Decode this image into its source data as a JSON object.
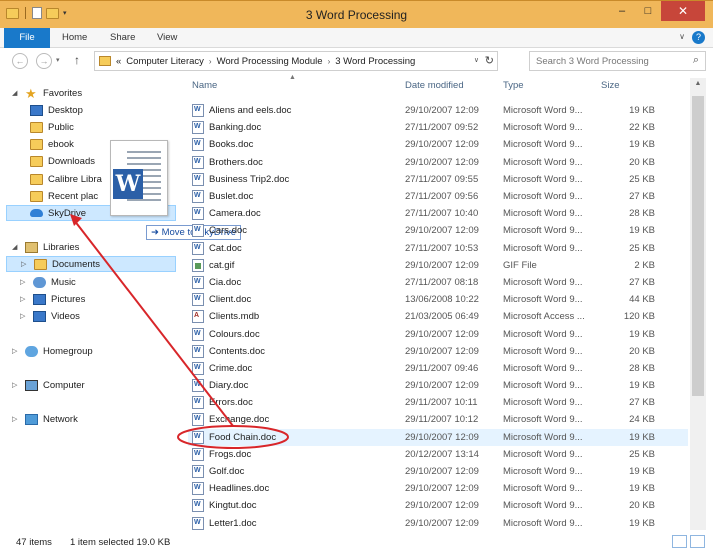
{
  "window": {
    "title": "3 Word Processing",
    "minimize": "–",
    "maximize": "□",
    "close": "✕"
  },
  "ribbon": {
    "tabs": [
      "File",
      "Home",
      "Share",
      "View"
    ],
    "help": "?"
  },
  "address": {
    "back": "←",
    "forward": "→",
    "up": "↑",
    "crumbs": [
      "Computer Literacy",
      "Word Processing Module",
      "3 Word Processing"
    ],
    "overflow": "«",
    "search_placeholder": "Search 3 Word Processing"
  },
  "nav": {
    "favorites": "Favorites",
    "favorite_items": [
      "Desktop",
      "Public",
      "ebook",
      "Downloads",
      "Calibre Libra",
      "Recent plac",
      "SkyDrive"
    ],
    "libraries": "Libraries",
    "library_items": [
      "Documents",
      "Music",
      "Pictures",
      "Videos"
    ],
    "homegroup": "Homegroup",
    "computer": "Computer",
    "network": "Network"
  },
  "drag": {
    "tooltip": "Move to SkyDrive",
    "logo_letter": "W"
  },
  "columns": {
    "name": "Name",
    "date": "Date modified",
    "type": "Type",
    "size": "Size"
  },
  "files": [
    {
      "name": "Aliens and eels.doc",
      "date": "29/10/2007 12:09",
      "type": "Microsoft Word 9...",
      "size": "19 KB",
      "icon": "doc"
    },
    {
      "name": "Banking.doc",
      "date": "27/11/2007 09:52",
      "type": "Microsoft Word 9...",
      "size": "22 KB",
      "icon": "doc"
    },
    {
      "name": "Books.doc",
      "date": "29/10/2007 12:09",
      "type": "Microsoft Word 9...",
      "size": "19 KB",
      "icon": "doc"
    },
    {
      "name": "Brothers.doc",
      "date": "29/10/2007 12:09",
      "type": "Microsoft Word 9...",
      "size": "20 KB",
      "icon": "doc"
    },
    {
      "name": "Business Trip2.doc",
      "date": "27/11/2007 09:55",
      "type": "Microsoft Word 9...",
      "size": "25 KB",
      "icon": "doc"
    },
    {
      "name": "Buslet.doc",
      "date": "27/11/2007 09:56",
      "type": "Microsoft Word 9...",
      "size": "27 KB",
      "icon": "doc"
    },
    {
      "name": "Camera.doc",
      "date": "27/11/2007 10:40",
      "type": "Microsoft Word 9...",
      "size": "28 KB",
      "icon": "doc"
    },
    {
      "name": "Cars.doc",
      "date": "29/10/2007 12:09",
      "type": "Microsoft Word 9...",
      "size": "19 KB",
      "icon": "doc"
    },
    {
      "name": "Cat.doc",
      "date": "27/11/2007 10:53",
      "type": "Microsoft Word 9...",
      "size": "25 KB",
      "icon": "doc"
    },
    {
      "name": "cat.gif",
      "date": "29/10/2007 12:09",
      "type": "GIF File",
      "size": "2 KB",
      "icon": "gif"
    },
    {
      "name": "Cia.doc",
      "date": "27/11/2007 08:18",
      "type": "Microsoft Word 9...",
      "size": "27 KB",
      "icon": "doc"
    },
    {
      "name": "Client.doc",
      "date": "13/06/2008 10:22",
      "type": "Microsoft Word 9...",
      "size": "44 KB",
      "icon": "doc"
    },
    {
      "name": "Clients.mdb",
      "date": "21/03/2005 06:49",
      "type": "Microsoft Access ...",
      "size": "120 KB",
      "icon": "mdb"
    },
    {
      "name": "Colours.doc",
      "date": "29/10/2007 12:09",
      "type": "Microsoft Word 9...",
      "size": "19 KB",
      "icon": "doc"
    },
    {
      "name": "Contents.doc",
      "date": "29/10/2007 12:09",
      "type": "Microsoft Word 9...",
      "size": "20 KB",
      "icon": "doc"
    },
    {
      "name": "Crime.doc",
      "date": "29/11/2007 09:46",
      "type": "Microsoft Word 9...",
      "size": "28 KB",
      "icon": "doc"
    },
    {
      "name": "Diary.doc",
      "date": "29/10/2007 12:09",
      "type": "Microsoft Word 9...",
      "size": "19 KB",
      "icon": "doc"
    },
    {
      "name": "Errors.doc",
      "date": "29/11/2007 10:11",
      "type": "Microsoft Word 9...",
      "size": "27 KB",
      "icon": "doc"
    },
    {
      "name": "Exchange.doc",
      "date": "29/11/2007 10:12",
      "type": "Microsoft Word 9...",
      "size": "24 KB",
      "icon": "doc"
    },
    {
      "name": "Food Chain.doc",
      "date": "29/10/2007 12:09",
      "type": "Microsoft Word 9...",
      "size": "19 KB",
      "icon": "doc",
      "selected": true
    },
    {
      "name": "Frogs.doc",
      "date": "20/12/2007 13:14",
      "type": "Microsoft Word 9...",
      "size": "25 KB",
      "icon": "doc"
    },
    {
      "name": "Golf.doc",
      "date": "29/10/2007 12:09",
      "type": "Microsoft Word 9...",
      "size": "19 KB",
      "icon": "doc"
    },
    {
      "name": "Headlines.doc",
      "date": "29/10/2007 12:09",
      "type": "Microsoft Word 9...",
      "size": "19 KB",
      "icon": "doc"
    },
    {
      "name": "Kingtut.doc",
      "date": "29/10/2007 12:09",
      "type": "Microsoft Word 9...",
      "size": "20 KB",
      "icon": "doc"
    },
    {
      "name": "Letter1.doc",
      "date": "29/10/2007 12:09",
      "type": "Microsoft Word 9...",
      "size": "19 KB",
      "icon": "doc"
    }
  ],
  "status": {
    "count": "47 items",
    "selection": "1 item selected  19.0 KB"
  },
  "colors": {
    "title_bar": "#f0b75a",
    "file_tab": "#1979ca",
    "annotation": "#d8262a",
    "selection": "#cde8ff"
  }
}
